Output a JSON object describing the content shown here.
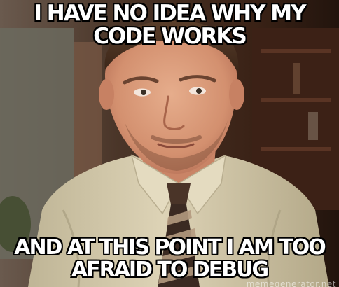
{
  "meme": {
    "top_text": "I HAVE NO IDEA WHY MY CODE WORKS",
    "bottom_text": "AND AT THIS POINT I AM TOO AFRAID TO DEBUG",
    "watermark": "memegenerator.net"
  },
  "colors": {
    "caption_fill": "#ffffff",
    "caption_stroke": "#000000",
    "shirt": "#d9cfb2",
    "skin": "#d99a7a",
    "tie_dark": "#3b2a22",
    "tie_light": "#b49a80",
    "background_dark": "#3a2418"
  }
}
